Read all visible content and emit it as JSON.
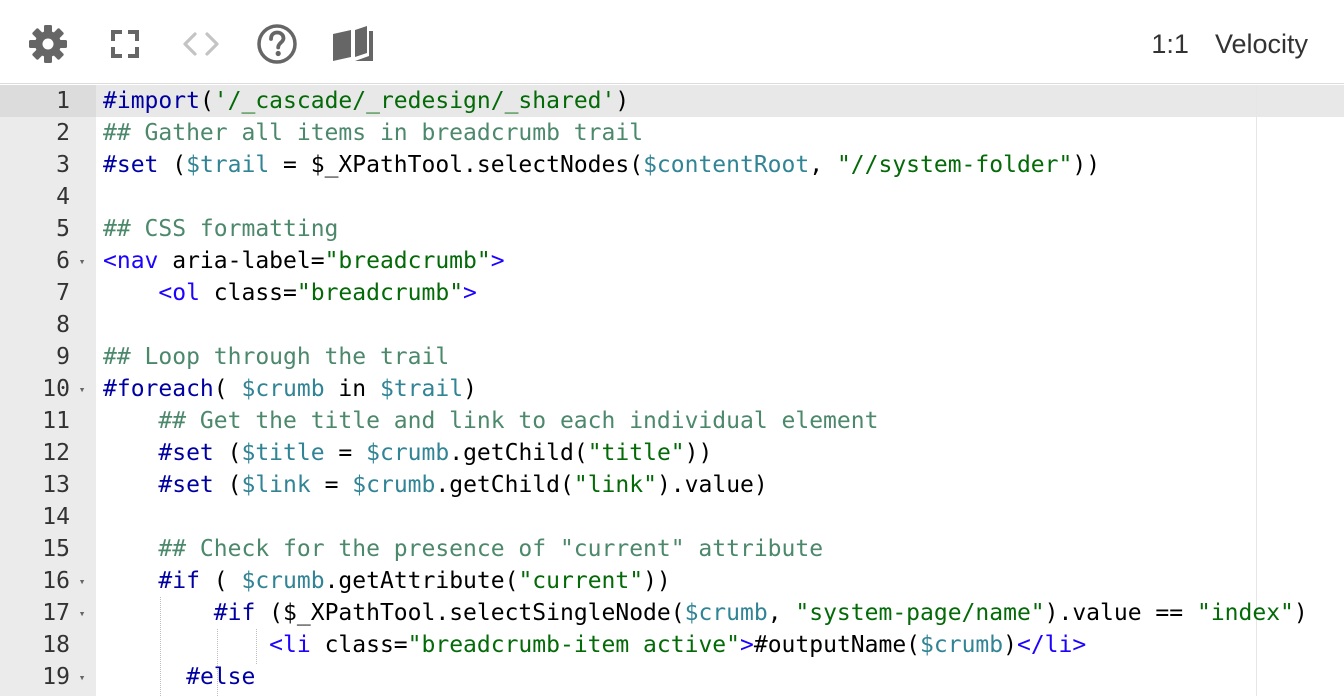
{
  "toolbar": {
    "icons": [
      "gear-icon",
      "fullscreen-icon",
      "code-brackets-icon",
      "help-icon",
      "book-icon"
    ],
    "ratio": "1:1",
    "language": "Velocity"
  },
  "colors": {
    "directive": "#0000a2",
    "comment": "#4c886b",
    "string": "#036a07",
    "variable": "#318495",
    "tag": "#1c02ff",
    "gutter_bg": "#ebebeb",
    "active_line_bg": "#e8e8e8"
  },
  "editor": {
    "active_line": 1,
    "lines": [
      {
        "number": "1",
        "fold": false,
        "tokens": [
          [
            "dir",
            "#import"
          ],
          [
            "txt",
            "("
          ],
          [
            "str",
            "'/_cascade/_redesign/_shared'"
          ],
          [
            "txt",
            ")"
          ]
        ]
      },
      {
        "number": "2",
        "fold": false,
        "tokens": [
          [
            "com",
            "## Gather all items in breadcrumb trail"
          ]
        ]
      },
      {
        "number": "3",
        "fold": false,
        "tokens": [
          [
            "dir",
            "#set"
          ],
          [
            "txt",
            " ("
          ],
          [
            "var",
            "$trail"
          ],
          [
            "txt",
            " = $_XPathTool.selectNodes("
          ],
          [
            "var",
            "$contentRoot"
          ],
          [
            "txt",
            ", "
          ],
          [
            "str",
            "\"//system-folder\""
          ],
          [
            "txt",
            "))"
          ]
        ]
      },
      {
        "number": "4",
        "fold": false,
        "tokens": []
      },
      {
        "number": "5",
        "fold": false,
        "tokens": [
          [
            "com",
            "## CSS formatting"
          ]
        ]
      },
      {
        "number": "6",
        "fold": true,
        "tokens": [
          [
            "tag",
            "<nav"
          ],
          [
            "txt",
            " aria-label="
          ],
          [
            "str",
            "\"breadcrumb\""
          ],
          [
            "tag",
            ">"
          ]
        ]
      },
      {
        "number": "7",
        "fold": false,
        "tokens": [
          [
            "txt",
            "    "
          ],
          [
            "tag",
            "<ol"
          ],
          [
            "txt",
            " class="
          ],
          [
            "str",
            "\"breadcrumb\""
          ],
          [
            "tag",
            ">"
          ]
        ]
      },
      {
        "number": "8",
        "fold": false,
        "tokens": []
      },
      {
        "number": "9",
        "fold": false,
        "tokens": [
          [
            "com",
            "## Loop through the trail"
          ]
        ]
      },
      {
        "number": "10",
        "fold": true,
        "tokens": [
          [
            "dir",
            "#foreach"
          ],
          [
            "txt",
            "( "
          ],
          [
            "var",
            "$crumb"
          ],
          [
            "txt",
            " in "
          ],
          [
            "var",
            "$trail"
          ],
          [
            "txt",
            ")"
          ]
        ]
      },
      {
        "number": "11",
        "fold": false,
        "tokens": [
          [
            "txt",
            "    "
          ],
          [
            "com",
            "## Get the title and link to each individual element"
          ]
        ]
      },
      {
        "number": "12",
        "fold": false,
        "tokens": [
          [
            "txt",
            "    "
          ],
          [
            "dir",
            "#set"
          ],
          [
            "txt",
            " ("
          ],
          [
            "var",
            "$title"
          ],
          [
            "txt",
            " = "
          ],
          [
            "var",
            "$crumb"
          ],
          [
            "txt",
            ".getChild("
          ],
          [
            "str",
            "\"title\""
          ],
          [
            "txt",
            "))"
          ]
        ]
      },
      {
        "number": "13",
        "fold": false,
        "tokens": [
          [
            "txt",
            "    "
          ],
          [
            "dir",
            "#set"
          ],
          [
            "txt",
            " ("
          ],
          [
            "var",
            "$link"
          ],
          [
            "txt",
            " = "
          ],
          [
            "var",
            "$crumb"
          ],
          [
            "txt",
            ".getChild("
          ],
          [
            "str",
            "\"link\""
          ],
          [
            "txt",
            ").value)"
          ]
        ]
      },
      {
        "number": "14",
        "fold": false,
        "tokens": []
      },
      {
        "number": "15",
        "fold": false,
        "tokens": [
          [
            "txt",
            "    "
          ],
          [
            "com",
            "## Check for the presence of \"current\" attribute"
          ]
        ]
      },
      {
        "number": "16",
        "fold": true,
        "tokens": [
          [
            "txt",
            "    "
          ],
          [
            "dir",
            "#if"
          ],
          [
            "txt",
            " ( "
          ],
          [
            "var",
            "$crumb"
          ],
          [
            "txt",
            ".getAttribute("
          ],
          [
            "str",
            "\"current\""
          ],
          [
            "txt",
            "))"
          ]
        ]
      },
      {
        "number": "17",
        "fold": true,
        "tokens": [
          [
            "txt",
            "        "
          ],
          [
            "dir",
            "#if"
          ],
          [
            "txt",
            " ($_XPathTool.selectSingleNode("
          ],
          [
            "var",
            "$crumb"
          ],
          [
            "txt",
            ", "
          ],
          [
            "str",
            "\"system-page/name\""
          ],
          [
            "txt",
            ").value == "
          ],
          [
            "str",
            "\"index\""
          ],
          [
            "txt",
            ")"
          ]
        ]
      },
      {
        "number": "18",
        "fold": false,
        "tokens": [
          [
            "txt",
            "            "
          ],
          [
            "tag",
            "<li"
          ],
          [
            "txt",
            " class="
          ],
          [
            "str",
            "\"breadcrumb-item active\""
          ],
          [
            "tag",
            ">"
          ],
          [
            "txt",
            "#outputName("
          ],
          [
            "var",
            "$crumb"
          ],
          [
            "txt",
            ")"
          ],
          [
            "tag",
            "</li>"
          ]
        ]
      },
      {
        "number": "19",
        "fold": true,
        "tokens": [
          [
            "txt",
            "      "
          ],
          [
            "dir",
            "#else"
          ]
        ]
      }
    ]
  }
}
